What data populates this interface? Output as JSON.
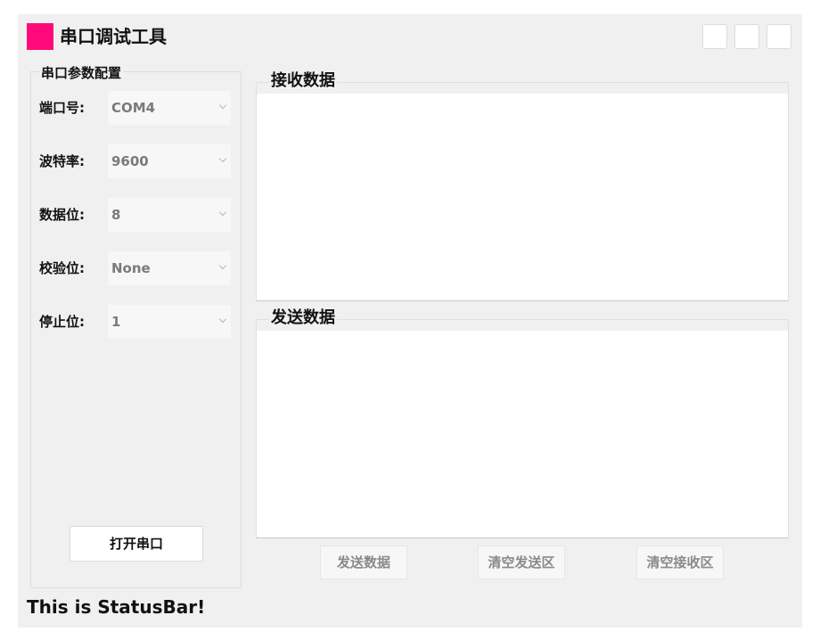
{
  "app": {
    "title": "串口调试工具",
    "logo_color": "#ff0a7a"
  },
  "settings": {
    "group_title": "串口参数配置",
    "fields": [
      {
        "label": "端口号:",
        "value": "COM4"
      },
      {
        "label": "波特率:",
        "value": "9600"
      },
      {
        "label": "数据位:",
        "value": "8"
      },
      {
        "label": "校验位:",
        "value": "None"
      },
      {
        "label": "停止位:",
        "value": "1"
      }
    ],
    "open_button": "打开串口"
  },
  "receive": {
    "title": "接收数据",
    "content": ""
  },
  "send": {
    "title": "发送数据",
    "content": ""
  },
  "actions": {
    "send": "发送数据",
    "clear_send": "清空发送区",
    "clear_receive": "清空接收区"
  },
  "status_bar": "This is StatusBar!"
}
